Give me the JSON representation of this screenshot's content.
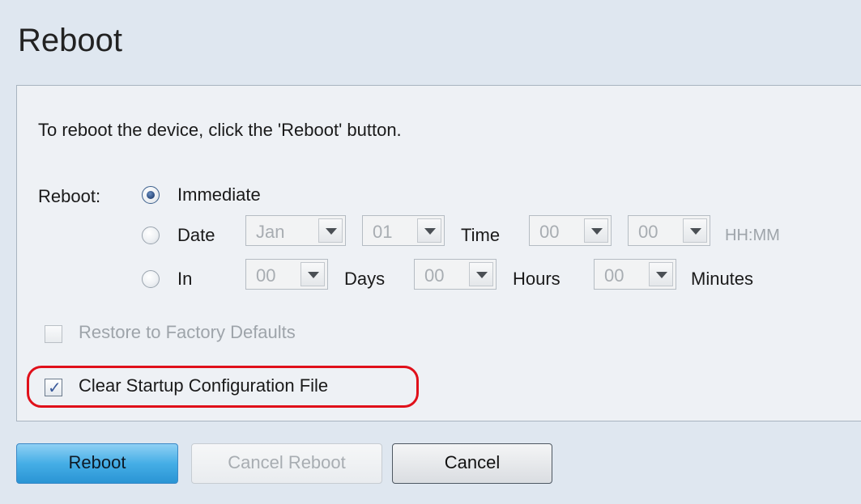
{
  "page": {
    "title": "Reboot"
  },
  "instructions": "To reboot the device, click the 'Reboot' button.",
  "reboot": {
    "label": "Reboot:",
    "immediate_label": "Immediate",
    "date_label": "Date",
    "date_month": "Jan",
    "date_day": "01",
    "time_label": "Time",
    "time_hour": "00",
    "time_minute": "00",
    "time_format": "HH:MM",
    "in_label": "In",
    "in_days": "00",
    "days_label": "Days",
    "in_hours": "00",
    "hours_label": "Hours",
    "in_minutes": "00",
    "minutes_label": "Minutes",
    "selected": "immediate"
  },
  "options": {
    "restore_label": "Restore to Factory Defaults",
    "restore_checked": false,
    "restore_disabled": true,
    "clear_label": "Clear Startup Configuration File",
    "clear_checked": true
  },
  "buttons": {
    "reboot": "Reboot",
    "cancel_reboot": "Cancel Reboot",
    "cancel": "Cancel"
  },
  "colors": {
    "highlight": "#e0101a",
    "primary_button": "#45aee6"
  }
}
